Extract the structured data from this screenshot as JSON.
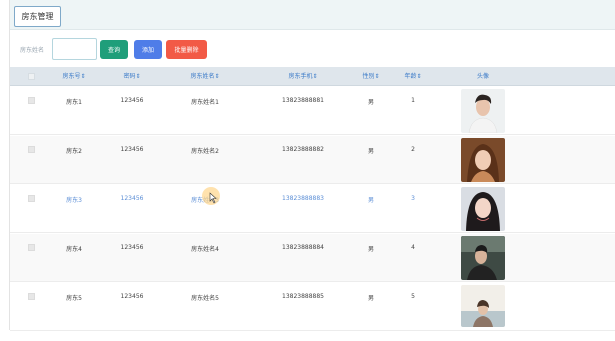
{
  "colors": {
    "link_blue": "#3a7ac8",
    "query_btn": "#1f9e7a",
    "add_btn": "#4f7de8",
    "batch_btn": "#f25a46"
  },
  "tabs": {
    "active": "房东管理"
  },
  "search": {
    "label": "房东姓名",
    "value": "",
    "query_label": "查询",
    "add_label": "添加",
    "batch_delete_label": "批量删除"
  },
  "table": {
    "columns": [
      "房东号⇕",
      "密码⇕",
      "房东姓名⇕",
      "房东手机⇕",
      "性别⇕",
      "年龄⇕",
      "头像"
    ],
    "rows": [
      {
        "id": "房东1",
        "password": "123456",
        "name": "房东姓名1",
        "phone": "13823888881",
        "gender": "男",
        "age": "1",
        "avatar": "portrait-man-white-shirt"
      },
      {
        "id": "房东2",
        "password": "123456",
        "name": "房东姓名2",
        "phone": "13823888882",
        "gender": "男",
        "age": "2",
        "avatar": "portrait-woman-brown-hair"
      },
      {
        "id": "房东3",
        "password": "123456",
        "name": "房东姓名3",
        "phone": "13823888883",
        "gender": "男",
        "age": "3",
        "avatar": "portrait-woman-dark-hair"
      },
      {
        "id": "房东4",
        "password": "123456",
        "name": "房东姓名4",
        "phone": "13823888884",
        "gender": "男",
        "age": "4",
        "avatar": "portrait-man-street"
      },
      {
        "id": "房东5",
        "password": "123456",
        "name": "房东姓名5",
        "phone": "13823888885",
        "gender": "男",
        "age": "5",
        "avatar": "portrait-woman-seaside"
      }
    ]
  }
}
